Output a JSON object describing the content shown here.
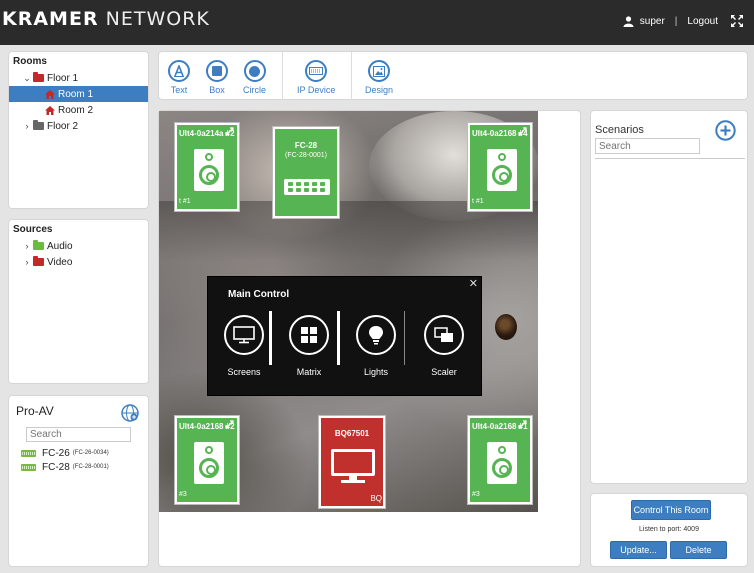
{
  "header": {
    "brand_bold": "KRAMER",
    "brand_rest": "NETWORK",
    "username": "super",
    "separator": "|",
    "logout_label": "Logout",
    "colors": {
      "bar": "#2b2b2b",
      "accent": "#3d7ec2",
      "kramer_red": "#d52b1e"
    }
  },
  "rooms": {
    "title": "Rooms",
    "floor1": {
      "label": "Floor 1",
      "rooms": [
        "Room 1",
        "Room 2"
      ],
      "selected": "Room 1"
    },
    "floor2": {
      "label": "Floor 2"
    }
  },
  "sources": {
    "title": "Sources",
    "items": [
      {
        "label": "Audio",
        "color": "#6cbb3c"
      },
      {
        "label": "Video",
        "color": "#c62828"
      }
    ]
  },
  "proav": {
    "title": "Pro-AV",
    "search_placeholder": "Search",
    "devices": [
      {
        "name": "FC-26",
        "id": "(FC-26-0034)"
      },
      {
        "name": "FC-28",
        "id": "(FC-28-0001)"
      }
    ]
  },
  "toolbar": {
    "text_label": "Text",
    "box_label": "Box",
    "circle_label": "Circle",
    "ipdevice_label": "IP Device",
    "design_label": "Design"
  },
  "canvas": {
    "tiles": {
      "tl": {
        "title": "Ult4-0a214a #2",
        "sub": "t #1"
      },
      "tr": {
        "title": "Ult4-0a2168 #4",
        "sub": "t #1"
      },
      "bl": {
        "title": "Ult4-0a2168 #2",
        "sub": "#3"
      },
      "br": {
        "title": "Ult4-0a2168 #1",
        "sub": "#3"
      }
    },
    "fc_tile": {
      "title": "FC-28",
      "sub": "(FC-28-0001)"
    },
    "bq_tile": {
      "title": "BQ67501",
      "bottom": "BQ"
    }
  },
  "main_control": {
    "title": "Main Control",
    "close": "✕",
    "items": [
      "Screens",
      "Matrix",
      "Lights",
      "Scaler"
    ]
  },
  "scenarios": {
    "title": "Scenarios",
    "search_placeholder": "Search"
  },
  "control": {
    "control_button": "Control This Room",
    "port_text": "Listen to port: 4009",
    "update_button": "Update...",
    "delete_button": "Delete"
  }
}
